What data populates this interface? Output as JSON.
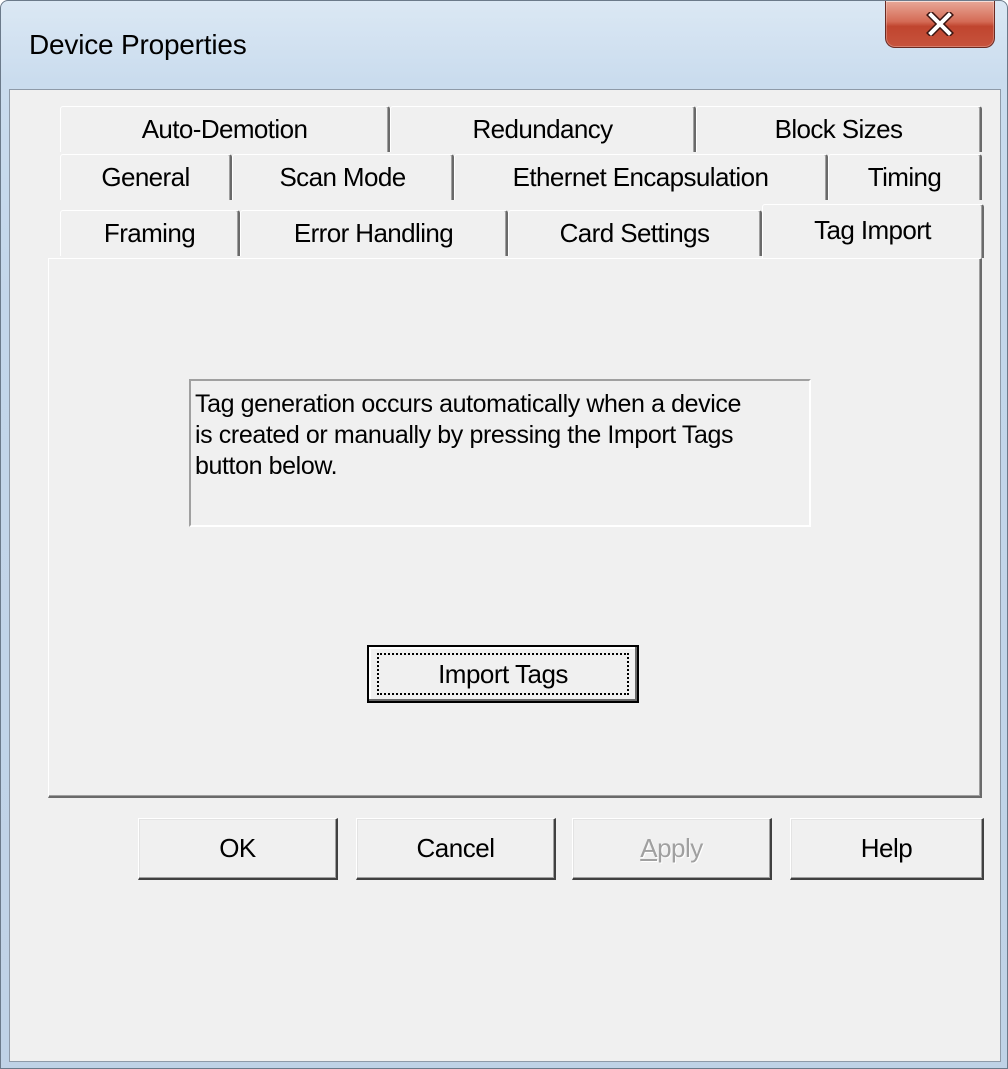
{
  "window": {
    "title": "Device Properties",
    "close_glyph": "X"
  },
  "tabs": {
    "row1": [
      "Auto-Demotion",
      "Redundancy",
      "Block Sizes"
    ],
    "row2": [
      "General",
      "Scan Mode",
      "Ethernet Encapsulation",
      "Timing"
    ],
    "row3": [
      "Framing",
      "Error Handling",
      "Card Settings",
      "Tag Import"
    ],
    "active": "Tag Import"
  },
  "panel": {
    "info_text": "Tag generation occurs automatically when a device is created or manually by pressing the Import Tags button below.",
    "import_button_label": "Import Tags"
  },
  "buttons": {
    "ok": "OK",
    "cancel": "Cancel",
    "apply": "Apply",
    "help": "Help"
  },
  "colors": {
    "close_button": "#c7533c",
    "dialog_face": "#f0f0f0",
    "title_bar": "#cadcee"
  },
  "icons": {
    "close": "close-icon"
  }
}
